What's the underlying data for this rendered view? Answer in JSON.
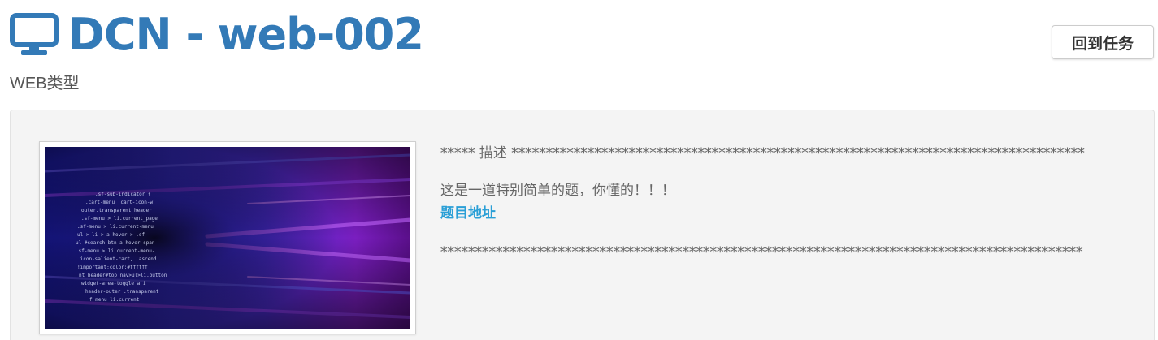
{
  "header": {
    "icon": "monitor-icon",
    "title": "DCN - web-002",
    "subtitle": "WEB类型",
    "accent_color": "#337ab7"
  },
  "actions": {
    "back_label": "回到任务"
  },
  "task": {
    "image": "code-screen-thumbnail",
    "desc_header": "***** 描述 ***********************************************************************************",
    "description": "这是一道特别简单的题，你懂的！！！",
    "link_label": "题目地址",
    "link_color": "#2a9fd6",
    "desc_footer": "*********************************************************************************************"
  }
}
